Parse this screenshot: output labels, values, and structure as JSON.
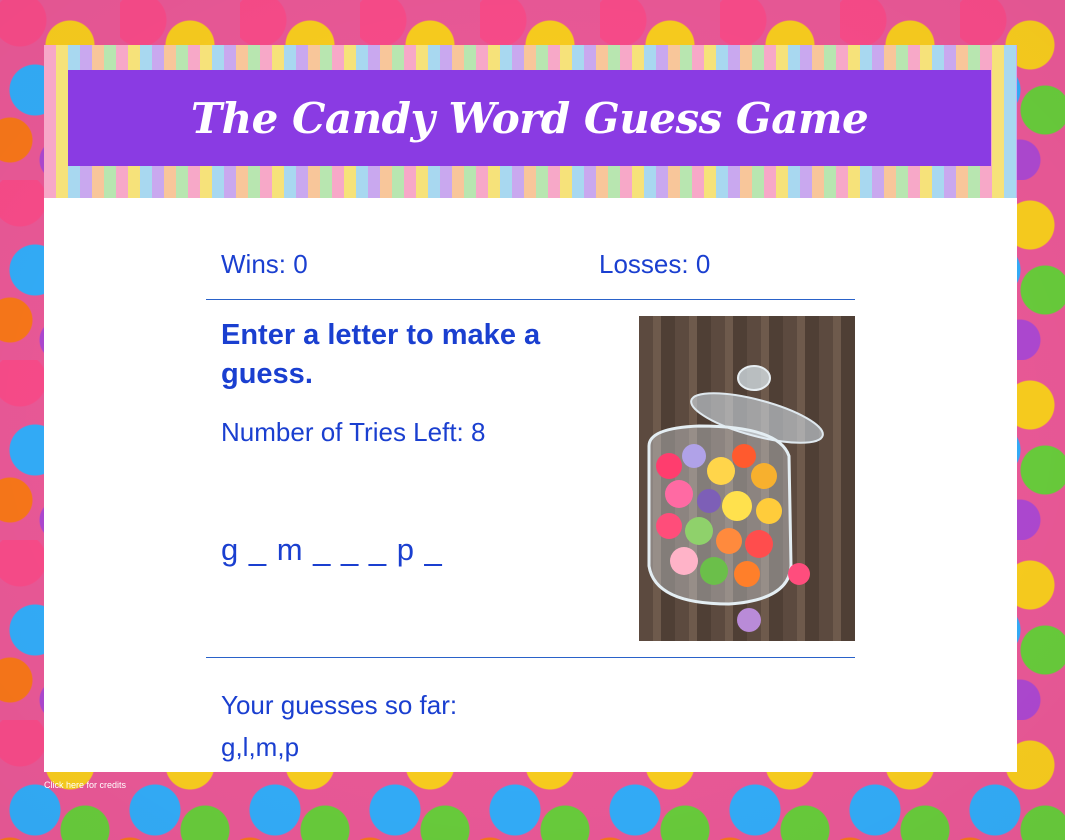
{
  "header": {
    "title": "The Candy Word Guess Game"
  },
  "score": {
    "wins": "Wins: 0",
    "losses": "Losses: 0"
  },
  "game": {
    "prompt": "Enter a letter to make a guess.",
    "tries_left": "Number of Tries Left: 8",
    "word_display": "g _ m _ _ _ p _",
    "guesses_label": "Your guesses so far:",
    "guesses_value": "g,l,m,p"
  },
  "footer": {
    "credits": "Click here for credits"
  },
  "colors": {
    "title_bar": "#8a3be3",
    "text": "#1a3fd0",
    "divider": "#2a62c9"
  },
  "images": {
    "jar": "candy-jar-photo"
  }
}
